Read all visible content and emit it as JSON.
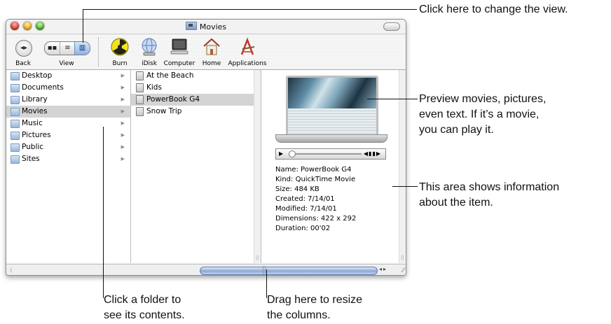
{
  "window": {
    "title": "Movies"
  },
  "toolbar": {
    "back_label": "Back",
    "view_label": "View",
    "view_modes": [
      "icon",
      "list",
      "column"
    ],
    "view_selected": "column",
    "items": [
      {
        "label": "Burn",
        "icon": "burn-icon"
      },
      {
        "label": "iDisk",
        "icon": "idisk-icon"
      },
      {
        "label": "Computer",
        "icon": "computer-icon"
      },
      {
        "label": "Home",
        "icon": "home-icon"
      },
      {
        "label": "Applications",
        "icon": "applications-icon"
      }
    ]
  },
  "column1": {
    "items": [
      {
        "label": "Desktop"
      },
      {
        "label": "Documents"
      },
      {
        "label": "Library"
      },
      {
        "label": "Movies",
        "selected": true
      },
      {
        "label": "Music"
      },
      {
        "label": "Pictures"
      },
      {
        "label": "Public"
      },
      {
        "label": "Sites"
      }
    ]
  },
  "column2": {
    "items": [
      {
        "label": "At the Beach"
      },
      {
        "label": "Kids"
      },
      {
        "label": "PowerBook G4",
        "selected": true
      },
      {
        "label": "Snow Trip"
      }
    ]
  },
  "preview": {
    "info": [
      "Name: PowerBook G4",
      "Kind: QuickTime Movie",
      "Size: 484 KB",
      "Created: 7/14/01",
      "Modified: 7/14/01",
      "Dimensions: 422 x 292",
      "Duration: 00'02"
    ]
  },
  "callouts": {
    "view": "Click here to change the view.",
    "preview_l1": "Preview movies, pictures,",
    "preview_l2": "even text. If it’s a movie,",
    "preview_l3": "you can play it.",
    "info_l1": "This area shows information",
    "info_l2": "about the item.",
    "folder_l1": "Click a folder to",
    "folder_l2": "see its contents.",
    "resize_l1": "Drag here to resize",
    "resize_l2": "the columns."
  },
  "colors": {
    "selection": "#d4d4d4",
    "scroll_thumb": "#8ea8d4",
    "view_selected": "#8fb3e6"
  }
}
